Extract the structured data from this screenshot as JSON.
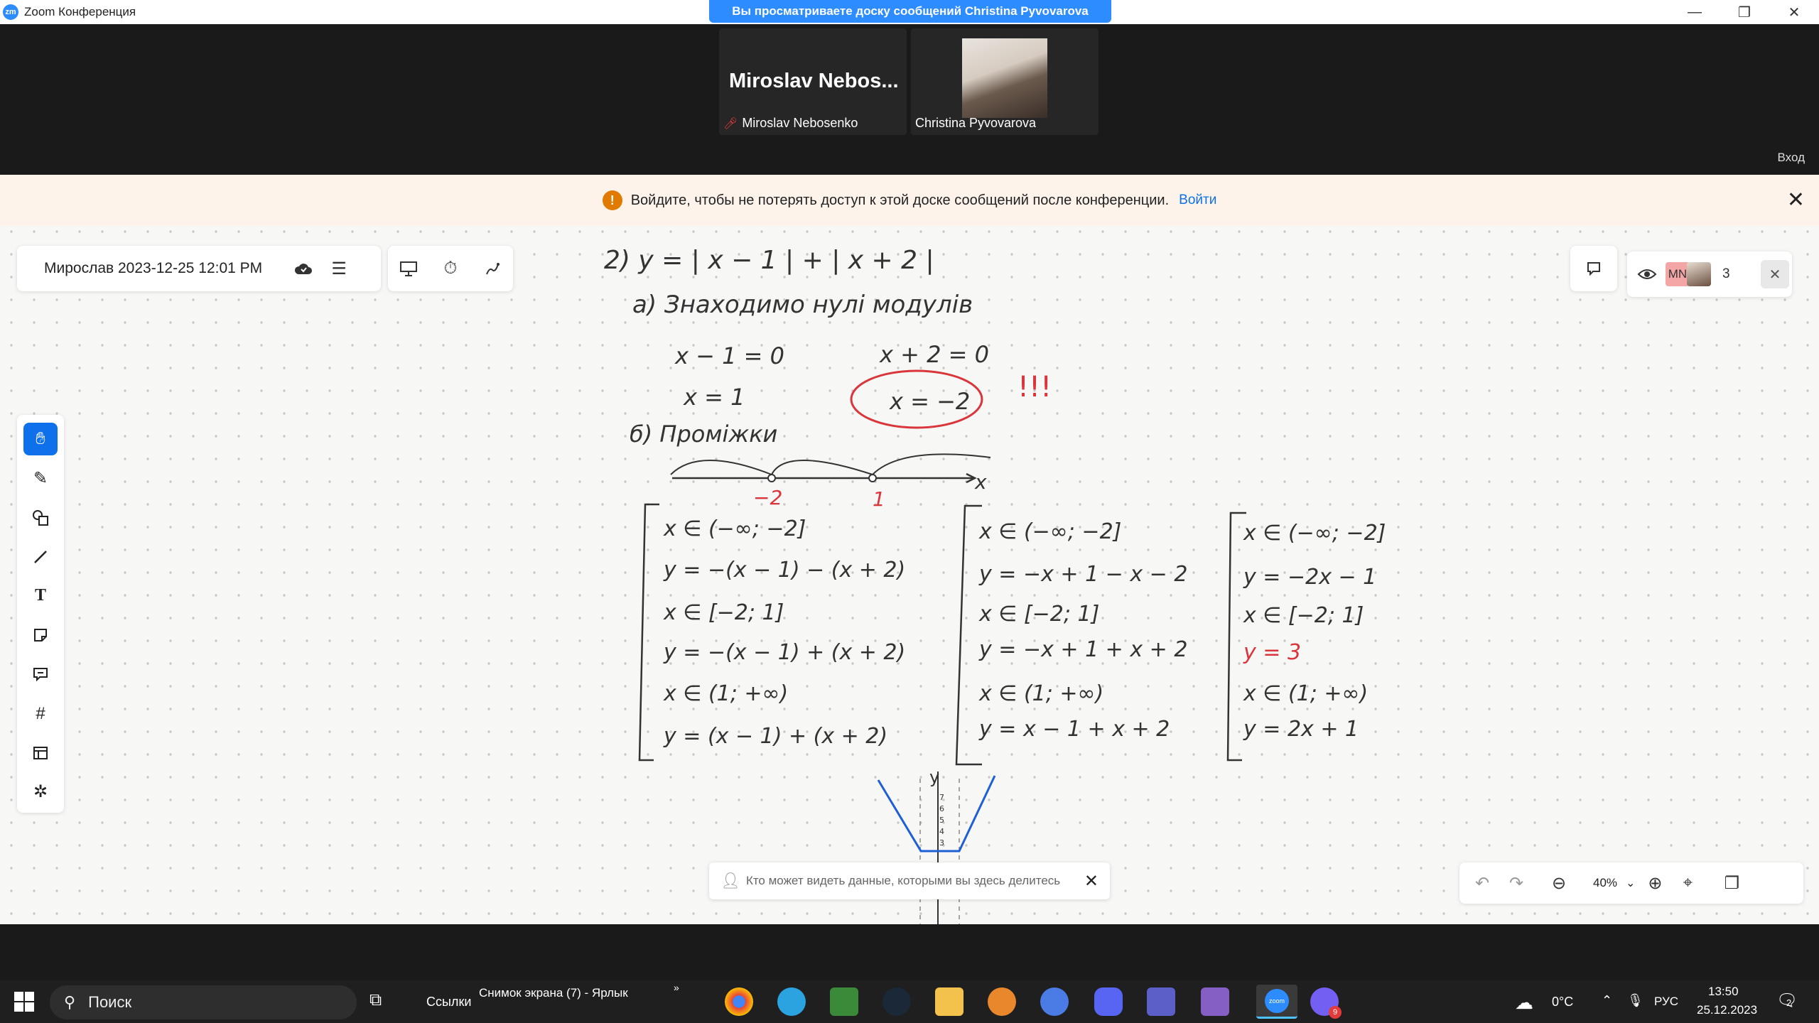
{
  "window": {
    "app_title": "Zoom Конференция",
    "logo_text": "zm",
    "share_banner": "Вы просматриваете доску сообщений Christina Pyvovarova",
    "minimize": "—",
    "restore": "❐",
    "close": "✕"
  },
  "video": {
    "tile1": {
      "big_name": "Miroslav  Nebos...",
      "label": "Miroslav Nebosenko"
    },
    "tile2": {
      "label": "Christina Pyvovarova"
    },
    "login": "Вход"
  },
  "notice": {
    "text": "Войдите, чтобы не потерять доступ к этой доске сообщений после конференции.",
    "link": "Войти"
  },
  "whiteboard": {
    "title": "Мирослав 2023-12-25 12:01 PM",
    "participants_count": "3",
    "participant_initials": "MN",
    "zoom_level": "40%",
    "share_hint": "Кто может видеть данные, которыми вы здесь делитесь"
  },
  "taskbar": {
    "search_placeholder": "Поиск",
    "links_label": "Ссылки",
    "shortcut_label": "Снимок экрана (7) - Ярлык",
    "temperature": "0°C",
    "lang": "РУС",
    "time": "13:50",
    "date": "25.12.2023",
    "notifications": "2",
    "viber_badge": "9"
  },
  "handwriting": {
    "l1": "2)    y = | x − 1 | + | x + 2 |",
    "l2": "а)  Знаходимо нулі модулів",
    "l3a": "x − 1 = 0",
    "l3b": "x + 2 = 0",
    "l4a": "x = 1",
    "l4b": "x = −2",
    "l4c": "!!!",
    "l5": "б)  Проміжки",
    "axis_x": "x",
    "tick1": "−2",
    "tick2": "1",
    "a1": "x ∈ (−∞; −2]",
    "a2": "y = −(x − 1) − (x + 2)",
    "a3": "x ∈ [−2; 1]",
    "a4": "y = −(x − 1) + (x + 2)",
    "a5": "x ∈ (1; +∞)",
    "a6": "y = (x − 1) + (x + 2)",
    "b1": "x ∈ (−∞; −2]",
    "b2": "y = −x + 1 − x − 2",
    "b3": "x ∈ [−2; 1]",
    "b4": "y = −x + 1 + x + 2",
    "b5": "x ∈ (1; +∞)",
    "b6": "y = x − 1 + x + 2",
    "c1": "x ∈ (−∞; −2]",
    "c2": "y = −2x − 1",
    "c3": "x ∈ [−2; 1]",
    "c4": "y = 3",
    "c5": "x ∈ (1; +∞)",
    "c6": "y = 2x + 1",
    "graph_axis": "y",
    "graph_ticks": [
      "7",
      "6",
      "5",
      "4",
      "3"
    ]
  },
  "colors": {
    "zoom_blue": "#2d8cff",
    "active_tool": "#0e71eb",
    "ink_red": "#d9353b",
    "ink_dark": "#333333",
    "graph_blue": "#1f5fd6"
  }
}
